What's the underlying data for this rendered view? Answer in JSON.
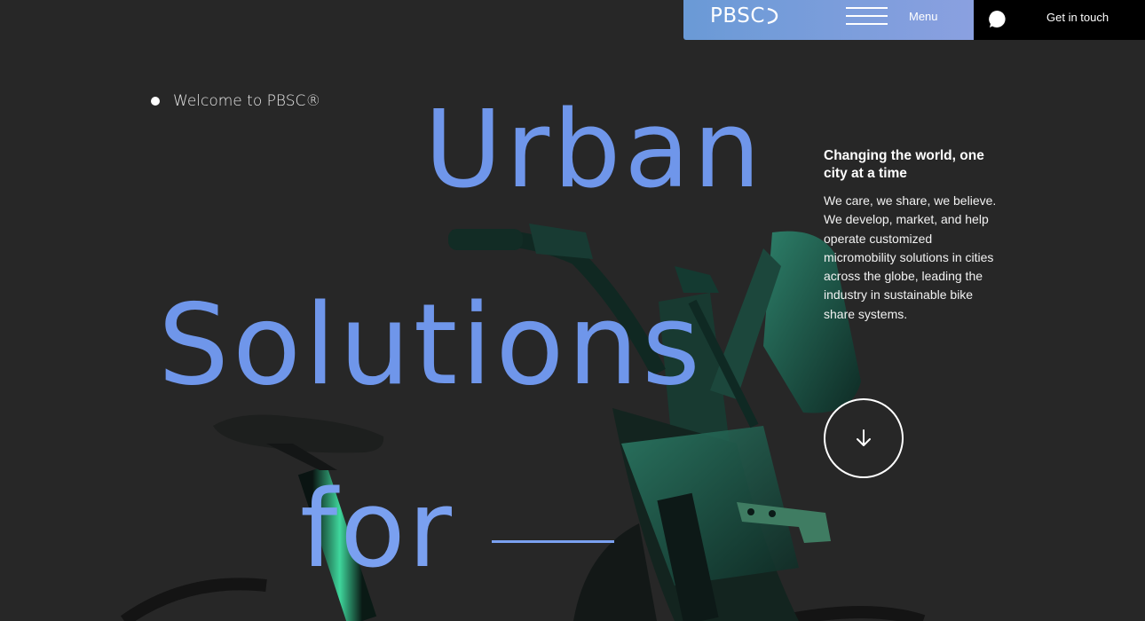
{
  "nav": {
    "logo_text": "PBSC",
    "menu_label": "Menu",
    "contact_label": "Get in touch"
  },
  "hero": {
    "welcome": "Welcome to PBSC®",
    "line1": "Urban",
    "line2": "Solutions",
    "line3": "for"
  },
  "intro": {
    "headline": "Changing the world, one city at a time",
    "para1": "We care, we share, we believe.",
    "para2": "We develop, market, and help operate customized micromobility solutions in cities across the globe, leading the industry in sustainable bike share systems."
  },
  "icons": {
    "menu": "hamburger-icon",
    "chat": "chat-bubble-icon",
    "scroll": "arrow-down-icon"
  },
  "colors": {
    "background": "#272727",
    "hero_text": "#6f96ea",
    "nav_gradient_start": "#6a9ad6",
    "nav_gradient_end": "#8aa0e0",
    "bike_accent": "#1f6b52"
  }
}
